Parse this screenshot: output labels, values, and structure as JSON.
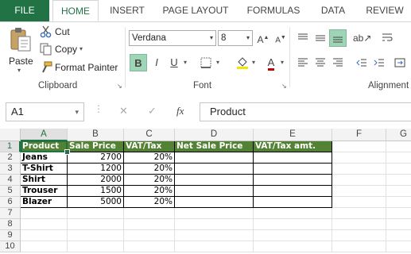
{
  "tabs": {
    "file": "FILE",
    "home": "HOME",
    "insert": "INSERT",
    "page_layout": "PAGE LAYOUT",
    "formulas": "FORMULAS",
    "data": "DATA",
    "review": "REVIEW"
  },
  "clipboard": {
    "paste": "Paste",
    "cut": "Cut",
    "copy": "Copy",
    "format_painter": "Format Painter",
    "group_label": "Clipboard"
  },
  "font": {
    "name": "Verdana",
    "size": "8",
    "bold": "B",
    "italic": "I",
    "underline": "U",
    "color_letter": "A",
    "group_label": "Font"
  },
  "alignment": {
    "group_label": "Alignment"
  },
  "formula_bar": {
    "name_box": "A1",
    "cancel_icon": "✕",
    "enter_icon": "✓",
    "fx_label": "fx",
    "content": "Product"
  },
  "columns": [
    "A",
    "B",
    "C",
    "D",
    "E",
    "F",
    "G"
  ],
  "rows": [
    "1",
    "2",
    "3",
    "4",
    "5",
    "6",
    "7",
    "8",
    "9",
    "10"
  ],
  "table": {
    "headers": [
      "Product",
      "Sale Price",
      "VAT/Tax",
      "Net Sale Price",
      "VAT/Tax amt."
    ],
    "data": [
      [
        "Jeans",
        "2700",
        "20%",
        "",
        ""
      ],
      [
        "T-Shirt",
        "1200",
        "20%",
        "",
        ""
      ],
      [
        "Shirt",
        "2000",
        "20%",
        "",
        ""
      ],
      [
        "Trouser",
        "1500",
        "20%",
        "",
        ""
      ],
      [
        "Blazer",
        "5000",
        "20%",
        "",
        ""
      ]
    ]
  },
  "colors": {
    "accent": "#217346",
    "header_fill": "#548235",
    "header_text": "#ffffff"
  }
}
